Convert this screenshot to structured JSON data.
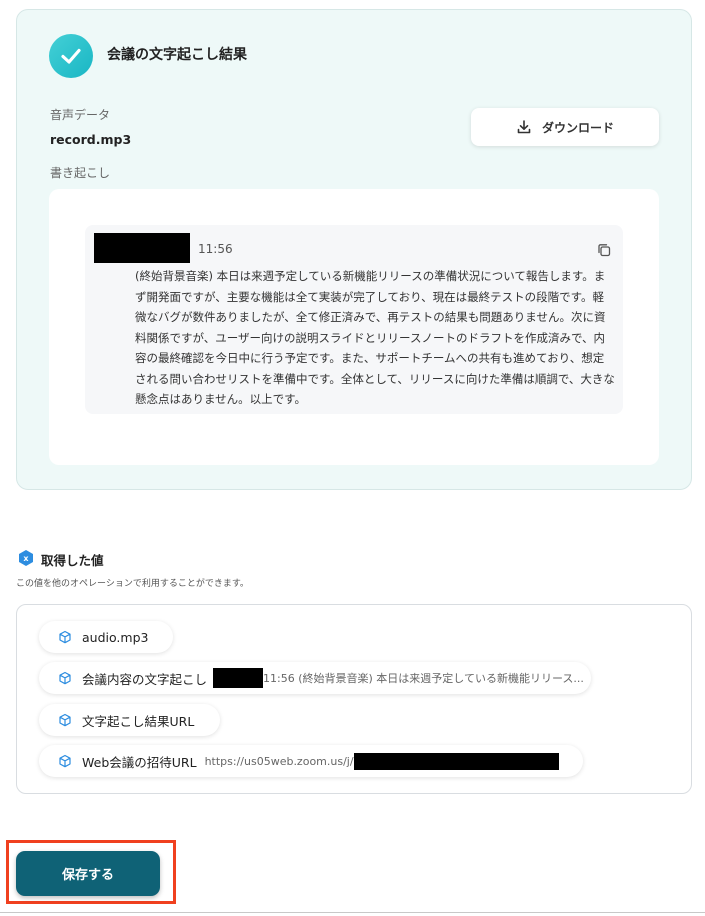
{
  "result": {
    "title": "会議の文字起こし結果",
    "audio_label": "音声データ",
    "audio_file": "record.mp3",
    "download_label": "ダウンロード",
    "transcript_label": "書き起こし",
    "message": {
      "time": "11:56",
      "text": "(終始背景音楽) 本日は来週予定している新機能リリースの準備状況について報告します。まず開発面ですが、主要な機能は全て実装が完了しており、現在は最終テストの段階です。軽微なバグが数件ありましたが、全て修正済みで、再テストの結果も問題ありません。次に資料関係ですが、ユーザー向けの説明スライドとリリースノートのドラフトを作成済みで、内容の最終確認を今日中に行う予定です。また、サポートチームへの共有も進めており、想定される問い合わせリストを準備中です。全体として、リリースに向けた準備は順調で、大きな懸念点はありません。以上です。"
    }
  },
  "obtained": {
    "title": "取得した値",
    "description": "この値を他のオペレーションで利用することができます。",
    "items": [
      {
        "label": "audio.mp3",
        "preview": ""
      },
      {
        "label": "会議内容の文字起こし",
        "preview": "11:56 (終始背景音楽) 本日は来週予定している新機能リリース..."
      },
      {
        "label": "文字起こし結果URL",
        "preview": ""
      },
      {
        "label": "Web会議の招待URL",
        "preview": "https://us05web.zoom.us/j/"
      }
    ]
  },
  "save_label": "保存する",
  "colors": {
    "accent": "#0f6276",
    "check": "#1fbfca",
    "highlight": "#f0401f",
    "card_bg": "#eef9f8"
  }
}
